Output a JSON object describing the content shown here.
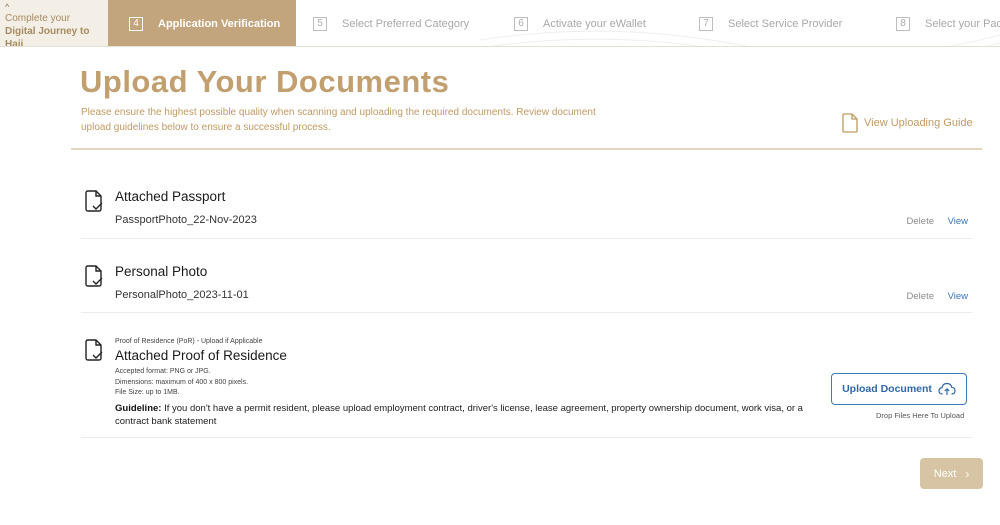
{
  "journey": {
    "caret": "^",
    "line1": "Complete your",
    "line2": "Digital Journey to Hajj"
  },
  "steps": [
    {
      "number": "4",
      "label": "Application Verification",
      "active": true
    },
    {
      "number": "5",
      "label": "Select Preferred Category",
      "active": false
    },
    {
      "number": "6",
      "label": "Activate your eWallet",
      "active": false
    },
    {
      "number": "7",
      "label": "Select Service Provider",
      "active": false
    },
    {
      "number": "8",
      "label": "Select your Pac",
      "active": false
    }
  ],
  "header": {
    "title": "Upload Your Documents",
    "description": "Please ensure the highest possible quality when scanning and uploading the required documents. Review document upload guidelines below to ensure a successful process.",
    "guide_link": "View Uploading Guide"
  },
  "documents": [
    {
      "title": "Attached Passport",
      "file": "PassportPhoto_22-Nov-2023",
      "delete_label": "Delete",
      "view_label": "View"
    },
    {
      "title": "Personal Photo",
      "file": "PersonalPhoto_2023-11-01",
      "delete_label": "Delete",
      "view_label": "View"
    },
    {
      "pre_label": "Proof of Residence (PoR) - Upload if Applicable",
      "title": "Attached Proof of Residence",
      "meta": [
        "Accepted format: PNG or JPG.",
        "Dimensions: maximum of 400 x 800 pixels.",
        "File Size: up to 1MB."
      ],
      "guideline_label": "Guideline:",
      "guideline_text": " If you don't have a permit resident, please upload employment contract, driver's license, lease agreement, property ownership document, work visa, or a contract bank statement",
      "upload_label": "Upload Document",
      "drop_hint": "Drop Files Here To Upload"
    }
  ],
  "footer": {
    "next_label": "Next",
    "next_icon": "chevron-right-icon"
  },
  "colors": {
    "accent_gold": "#c3a57d",
    "title_gold": "#c19f6e",
    "link_blue": "#3a76b6",
    "next_disabled": "#d7c4a5"
  }
}
